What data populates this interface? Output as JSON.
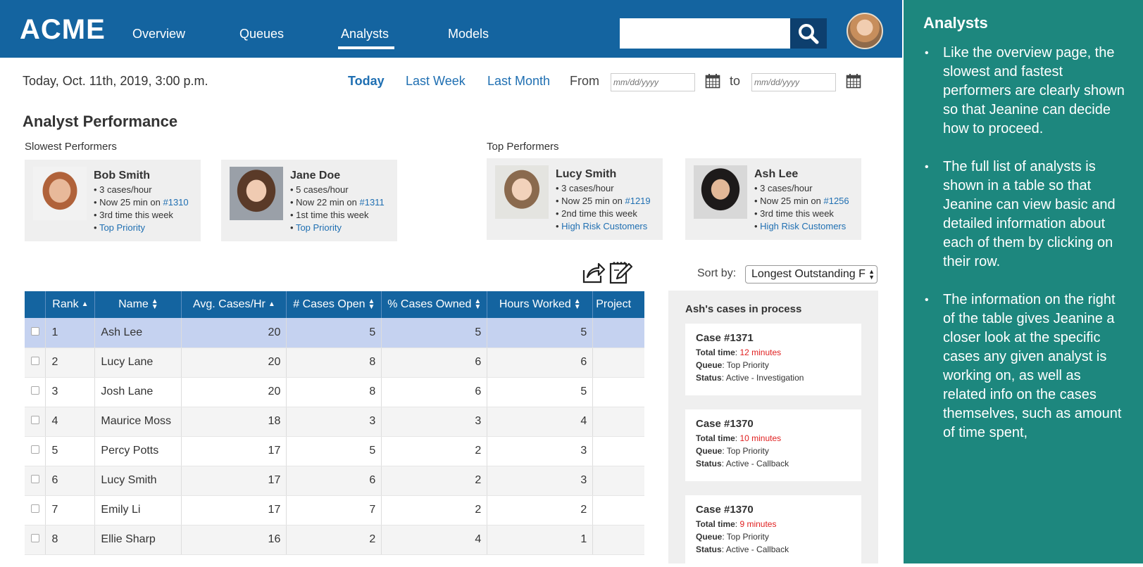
{
  "app": {
    "logo": "ACME"
  },
  "nav": {
    "items": [
      {
        "label": "Overview"
      },
      {
        "label": "Queues"
      },
      {
        "label": "Analysts"
      },
      {
        "label": "Models"
      }
    ],
    "active": "Analysts"
  },
  "search": {
    "placeholder": ""
  },
  "date": {
    "current": "Today, Oct. 11th, 2019, 3:00 p.m.",
    "ranges": [
      "Today",
      "Last Week",
      "Last Month"
    ],
    "from_label": "From",
    "to_label": "to",
    "from_placeholder": "mm/dd/yyyy",
    "to_placeholder": "mm/dd/yyyy"
  },
  "page_title": "Analyst Performance",
  "slowest_label": "Slowest Performers",
  "top_label": "Top Performers",
  "performers": [
    {
      "name": "Bob Smith",
      "rate": "• 3 cases/hour",
      "now": "• Now 25 min on ",
      "case": "#1310",
      "times": "• 3rd time this week",
      "queue": "Top Priority"
    },
    {
      "name": "Jane Doe",
      "rate": "• 5 cases/hour",
      "now": "• Now 22 min on ",
      "case": "#1311",
      "times": "• 1st time this week",
      "queue": "Top Priority"
    },
    {
      "name": "Lucy Smith",
      "rate": "• 3 cases/hour",
      "now": "• Now 25 min on ",
      "case": "#1219",
      "times": "• 2nd time this week",
      "queue": "High Risk Customers"
    },
    {
      "name": "Ash Lee",
      "rate": "• 3 cases/hour",
      "now": "• Now 25 min on ",
      "case": "#1256",
      "times": "• 3rd time this week",
      "queue": "High Risk Customers"
    }
  ],
  "table": {
    "headers": [
      "Rank",
      "Name",
      "Avg. Cases/Hr",
      "# Cases Open",
      "% Cases Owned",
      "Hours Worked",
      "Project"
    ],
    "rows": [
      {
        "rank": "1",
        "name": "Ash Lee",
        "avg": "20",
        "open": "5",
        "owned": "5",
        "hours": "5"
      },
      {
        "rank": "2",
        "name": "Lucy Lane",
        "avg": "20",
        "open": "8",
        "owned": "6",
        "hours": "6"
      },
      {
        "rank": "3",
        "name": "Josh Lane",
        "avg": "20",
        "open": "8",
        "owned": "6",
        "hours": "5"
      },
      {
        "rank": "4",
        "name": "Maurice Moss",
        "avg": "18",
        "open": "3",
        "owned": "3",
        "hours": "4"
      },
      {
        "rank": "5",
        "name": "Percy Potts",
        "avg": "17",
        "open": "5",
        "owned": "2",
        "hours": "3"
      },
      {
        "rank": "6",
        "name": "Lucy Smith",
        "avg": "17",
        "open": "6",
        "owned": "2",
        "hours": "3"
      },
      {
        "rank": "7",
        "name": "Emily Li",
        "avg": "17",
        "open": "7",
        "owned": "2",
        "hours": "2"
      },
      {
        "rank": "8",
        "name": "Ellie Sharp",
        "avg": "16",
        "open": "2",
        "owned": "4",
        "hours": "1"
      }
    ]
  },
  "sort": {
    "label": "Sort by:",
    "value": "Longest Outstanding F"
  },
  "cases": {
    "title": "Ash's cases in process",
    "items": [
      {
        "case": "Case #1371",
        "total_label": "Total time",
        "total": "12 minutes",
        "queue_label": "Queue",
        "queue": "Top Priority",
        "status_label": "Status",
        "status": "Active - Investigation"
      },
      {
        "case": "Case #1370",
        "total_label": "Total time",
        "total": "10 minutes",
        "queue_label": "Queue",
        "queue": "Top Priority",
        "status_label": "Status",
        "status": "Active - Callback"
      },
      {
        "case": "Case #1370",
        "total_label": "Total time",
        "total": "9 minutes",
        "queue_label": "Queue",
        "queue": "Top Priority",
        "status_label": "Status",
        "status": "Active - Callback"
      }
    ]
  },
  "notes": {
    "title": "Analysts",
    "bullets": [
      "Like the overview page, the slowest and fastest performers are clearly shown so that Jeanine can decide how to proceed.",
      "The full list of analysts is shown in a table so that Jeanine can view basic and detailed information about each of them by clicking on their row.",
      "The information on the right of the table gives Jeanine a closer look at the specific cases any given analyst is working on, as well as related info on the cases themselves, such as amount of time spent,"
    ]
  },
  "colors": {
    "nav_bg": "#1464a0",
    "notes_bg": "#1d877e",
    "link": "#1f6fb2",
    "selected_row": "#c5d2f0",
    "alert": "#e02020"
  }
}
